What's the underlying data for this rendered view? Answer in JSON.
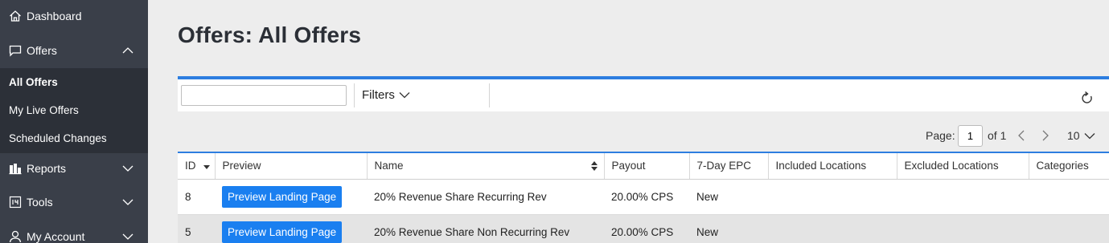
{
  "sidebar": {
    "items": [
      {
        "label": "Dashboard",
        "icon": "home-icon"
      },
      {
        "label": "Offers",
        "icon": "speech-bubble-icon",
        "expanded": true
      },
      {
        "label": "Reports",
        "icon": "bar-chart-icon"
      },
      {
        "label": "Tools",
        "icon": "tools-grid-icon"
      },
      {
        "label": "My Account",
        "icon": "user-icon"
      }
    ],
    "offers_sub": [
      {
        "label": "All Offers",
        "active": true
      },
      {
        "label": "My Live Offers"
      },
      {
        "label": "Scheduled Changes"
      }
    ]
  },
  "page": {
    "title": "Offers: All Offers"
  },
  "toolbar": {
    "search_value": "",
    "filters_label": "Filters"
  },
  "pagination": {
    "page_label": "Page:",
    "current_page": "1",
    "of_label": "of 1",
    "per_page": "10"
  },
  "table": {
    "columns": [
      "ID",
      "Preview",
      "Name",
      "Payout",
      "7-Day EPC",
      "Included Locations",
      "Excluded Locations",
      "Categories"
    ],
    "rows": [
      {
        "id": "8",
        "preview": "Preview Landing Page",
        "name": "20% Revenue Share Recurring Rev",
        "payout": "20.00% CPS",
        "epc": "New",
        "included": "",
        "excluded": "",
        "categories": ""
      },
      {
        "id": "5",
        "preview": "Preview Landing Page",
        "name": "20% Revenue Share Non Recurring Rev",
        "payout": "20.00% CPS",
        "epc": "New",
        "included": "",
        "excluded": "",
        "categories": ""
      }
    ]
  },
  "colors": {
    "sidebar_bg": "#3a3f49",
    "subnav_bg": "#2c3038",
    "accent": "#2d7ee0",
    "button": "#1a7ff0"
  }
}
